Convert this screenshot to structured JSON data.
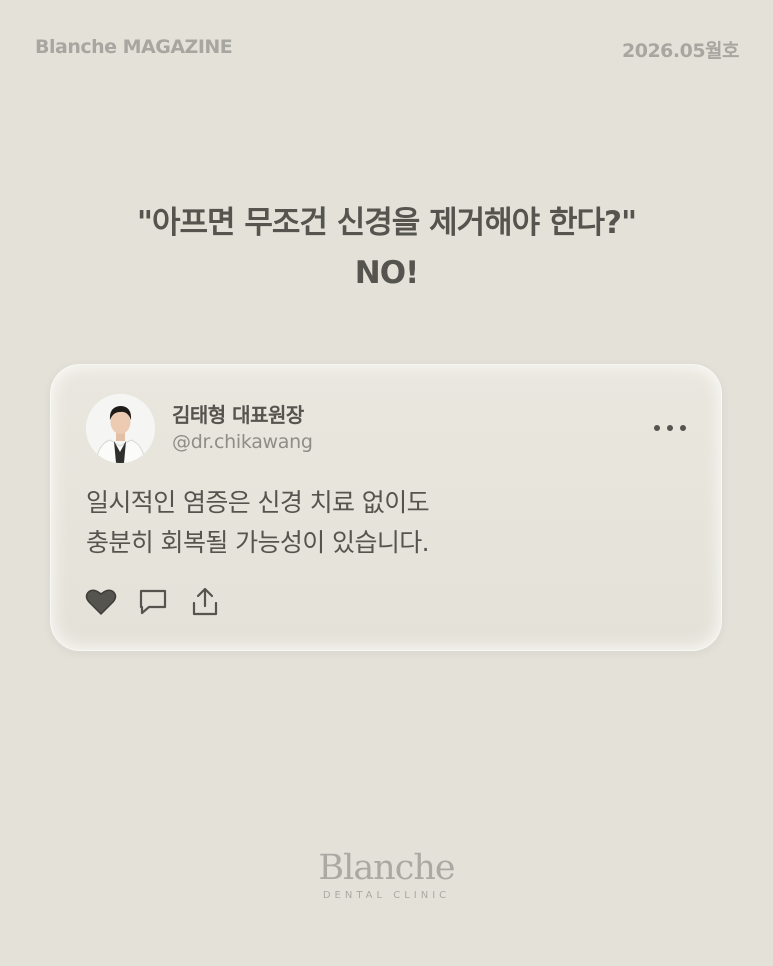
{
  "header": {
    "magazine": "Blanche MAGAZINE",
    "issue": "2026.05월호"
  },
  "headline": {
    "line1": "\"아프면 무조건 신경을 제거해야 한다?\"",
    "line2": "NO!"
  },
  "post": {
    "author_name": "김태형 대표원장",
    "author_handle": "@dr.chikawang",
    "body_line1": "일시적인 염증은 신경 치료 없이도",
    "body_line2": "충분히 회복될 가능성이 있습니다."
  },
  "icons": {
    "avatar": "doctor-portrait",
    "more": "more-dots-icon",
    "like": "heart-icon",
    "comment": "comment-icon",
    "share": "share-icon"
  },
  "logo": {
    "main": "Blanche",
    "sub": "DENTAL CLINIC"
  },
  "colors": {
    "background": "#e4e2d8",
    "text": "#55544f",
    "muted": "#a7a6a0"
  }
}
